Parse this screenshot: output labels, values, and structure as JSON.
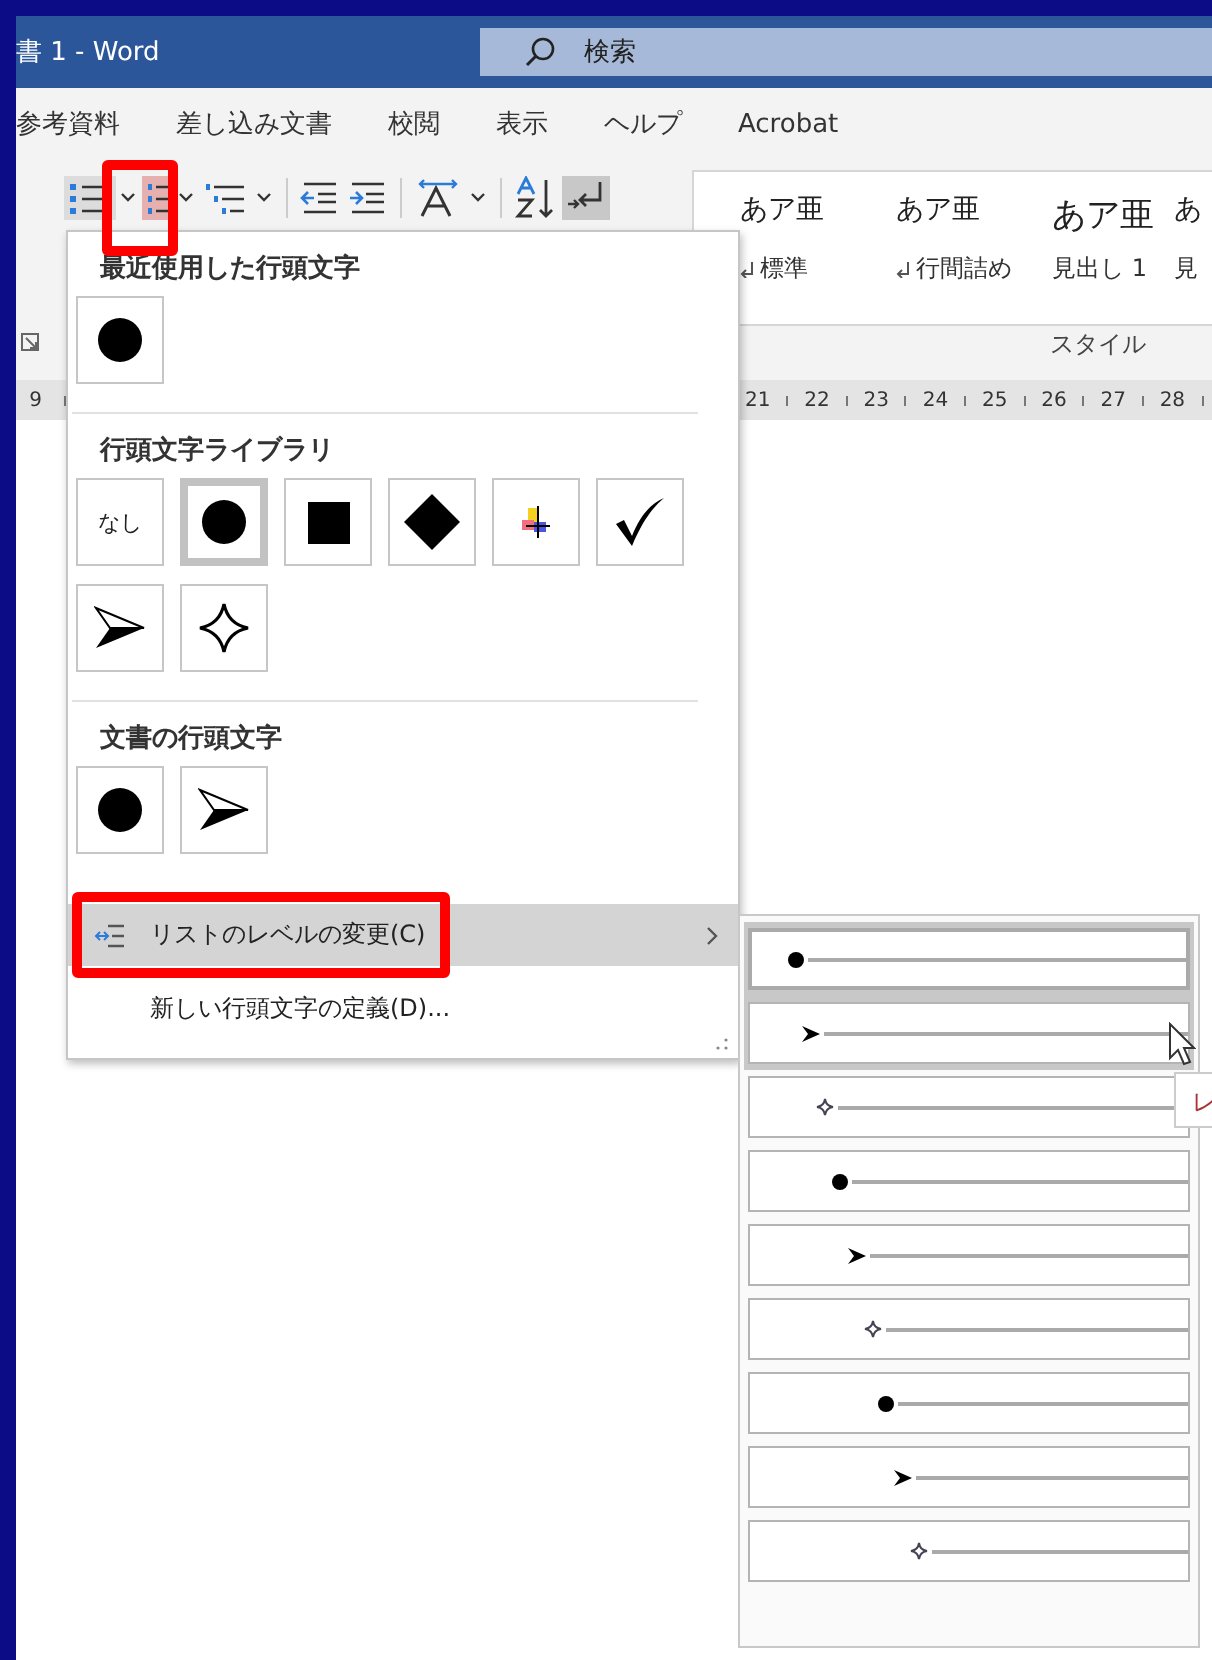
{
  "window": {
    "title": "書 1 - Word"
  },
  "search": {
    "placeholder": "検索"
  },
  "ribbon_tabs": [
    "参考資料",
    "差し込み文書",
    "校閲",
    "表示",
    "ヘルプ",
    "Acrobat"
  ],
  "styles": {
    "items": [
      {
        "sample": "あア亜",
        "name": "標準",
        "paragraph_mark": true,
        "kind": "body"
      },
      {
        "sample": "あア亜",
        "name": "行間詰め",
        "paragraph_mark": true,
        "kind": "body"
      },
      {
        "sample": "あア亜",
        "name": "見出し 1",
        "paragraph_mark": false,
        "kind": "heading"
      },
      {
        "sample": "あ",
        "name": "見",
        "paragraph_mark": false,
        "kind": "body"
      }
    ],
    "group_label": "スタイル"
  },
  "ruler": {
    "labels": [
      "9",
      "21",
      "22",
      "23",
      "24",
      "25",
      "26",
      "27",
      "28"
    ]
  },
  "bullet_menu": {
    "sections": [
      {
        "title": "最近使用した行頭文字",
        "bullets": [
          {
            "kind": "dot",
            "selected": false
          }
        ]
      },
      {
        "title": "行頭文字ライブラリ",
        "bullets": [
          {
            "kind": "none",
            "label": "なし",
            "selected": false
          },
          {
            "kind": "dot",
            "selected": true
          },
          {
            "kind": "square",
            "selected": false
          },
          {
            "kind": "diamond",
            "selected": false
          },
          {
            "kind": "picture",
            "selected": false
          },
          {
            "kind": "check",
            "selected": false
          },
          {
            "kind": "arrow",
            "selected": false
          },
          {
            "kind": "star",
            "selected": false
          }
        ]
      },
      {
        "title": "文書の行頭文字",
        "bullets": [
          {
            "kind": "dot",
            "selected": false
          },
          {
            "kind": "arrow",
            "selected": false
          }
        ]
      }
    ],
    "items": [
      {
        "label": "リストのレベルの変更(C)",
        "selected": true,
        "submenu": true
      },
      {
        "label": "新しい行頭文字の定義(D)...",
        "selected": false,
        "submenu": false
      }
    ]
  },
  "level_menu": {
    "levels": [
      {
        "kind": "dot",
        "selected": true,
        "hovered": false
      },
      {
        "kind": "arrow",
        "selected": false,
        "hovered": true
      },
      {
        "kind": "star",
        "selected": false,
        "hovered": false
      },
      {
        "kind": "dot",
        "selected": false,
        "hovered": false
      },
      {
        "kind": "arrow",
        "selected": false,
        "hovered": false
      },
      {
        "kind": "star",
        "selected": false,
        "hovered": false
      },
      {
        "kind": "dot",
        "selected": false,
        "hovered": false
      },
      {
        "kind": "arrow",
        "selected": false,
        "hovered": false
      },
      {
        "kind": "star",
        "selected": false,
        "hovered": false
      }
    ]
  },
  "tooltip": {
    "text": "レ"
  }
}
